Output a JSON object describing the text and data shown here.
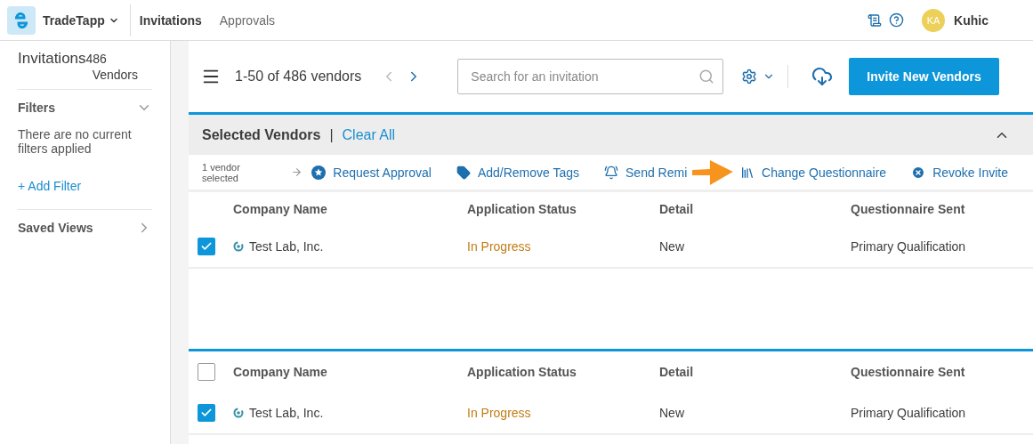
{
  "app": {
    "name": "TradeTapp"
  },
  "nav": [
    {
      "label": "Invitations",
      "selected": true
    },
    {
      "label": "Approvals",
      "selected": false
    }
  ],
  "user": {
    "initials": "KA",
    "name": "Kuhic"
  },
  "sidebar": {
    "title": "Invitations",
    "count": "486",
    "count_label": "Vendors",
    "filters": {
      "title": "Filters",
      "expanded": true,
      "empty_text": "There are no current filters applied",
      "add": "+ Add Filter"
    },
    "saved_views": {
      "title": "Saved Views",
      "expanded": false
    }
  },
  "toolbar": {
    "pager": "1-50 of 486 vendors",
    "prev_disabled": true,
    "next_disabled": false,
    "search": {
      "placeholder": "Search for an invitation"
    },
    "invite_button": "Invite New Vendors"
  },
  "selected_panel": {
    "title": "Selected Vendors",
    "separator": "|",
    "clear": "Clear All",
    "expanded": true,
    "count_text": "1 vendor selected",
    "actions": [
      {
        "kind": "approval",
        "label": "Request Approval"
      },
      {
        "kind": "tags",
        "label": "Add/Remove Tags"
      },
      {
        "kind": "reminder",
        "label": "Send Remi"
      },
      {
        "kind": "questionnaire",
        "label": "Change Questionnaire"
      },
      {
        "kind": "revoke",
        "label": "Revoke Invite"
      }
    ]
  },
  "tables": [
    {
      "columns": [
        "Company Name",
        "Application Status",
        "Detail",
        "Questionnaire Sent"
      ],
      "rows": [
        {
          "company": "Test Lab, Inc.",
          "status": "In Progress",
          "detail": "New",
          "questionnaire": "Primary Qualification",
          "selected": true
        }
      ]
    },
    {
      "select_all": {
        "checked": false
      },
      "columns": [
        "Company Name",
        "Application Status",
        "Detail",
        "Questionnaire Sent"
      ],
      "rows": [
        {
          "company": "Test Lab, Inc.",
          "status": "In Progress",
          "detail": "New",
          "questionnaire": "Primary Qualification",
          "selected": true
        }
      ]
    }
  ]
}
